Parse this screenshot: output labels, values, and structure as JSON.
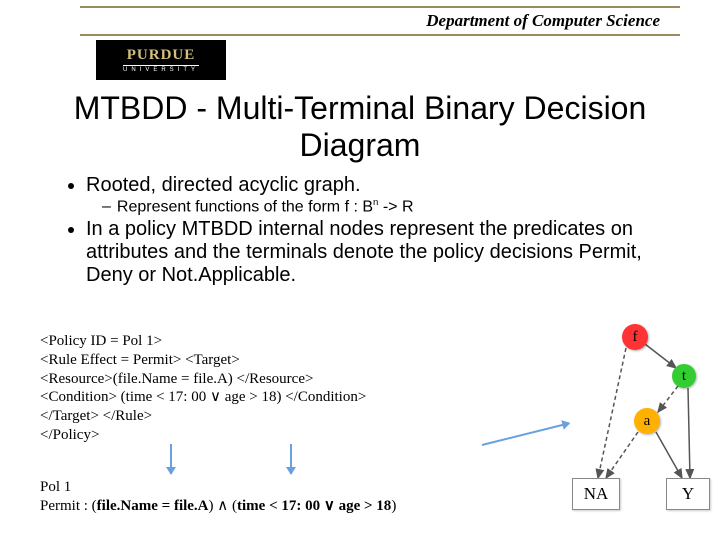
{
  "header": {
    "department": "Department of Computer Science"
  },
  "logo": {
    "main": "PURDUE",
    "sub": "UNIVERSITY"
  },
  "title": "MTBDD - Multi-Terminal Binary Decision Diagram",
  "bullets": {
    "b1": "Rooted, directed acyclic graph.",
    "b1_sub_prefix": "Represent functions of the form f : B",
    "b1_sub_sup": "n",
    "b1_sub_suffix": " -> R",
    "b2": "In a policy MTBDD internal nodes represent the predicates on attributes and the terminals denote the policy decisions Permit, Deny or Not.Applicable."
  },
  "code": {
    "l1": "<Policy ID = Pol 1>",
    "l2": "<Rule Effect = Permit> <Target>",
    "l3": "<Resource>(file.Name = file.A) </Resource>",
    "l4": "<Condition> (time < 17: 00 ∨ age > 18) </Condition>",
    "l5": "</Target> </Rule>",
    "l6": "</Policy>"
  },
  "summary": {
    "l1": "Pol 1",
    "l2a": "Permit : (",
    "l2b": "file.Name = file.A",
    "l2c": ") ",
    "wedge1": "∧",
    "l2d": " (",
    "l2e": "time < 17: 00 ",
    "vee": "∨",
    "l2f": " age > 18",
    "l2g": ")"
  },
  "diagram": {
    "f": "f",
    "t": "t",
    "a": "a",
    "na": "NA",
    "y": "Y"
  }
}
